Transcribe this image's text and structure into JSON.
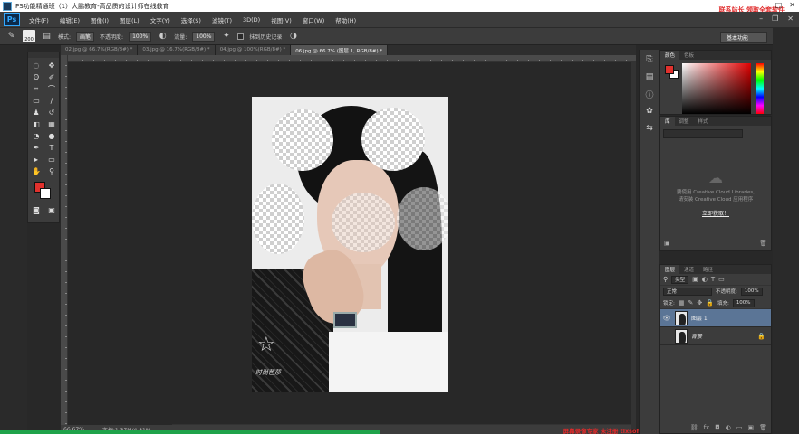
{
  "window": {
    "title": "PS功能精通班（1）大鹏教育-高品质的设计师在线教育",
    "watermark_top": "联系站长 领取全套软件"
  },
  "menu": {
    "logo": "Ps",
    "items": [
      "文件(F)",
      "编辑(E)",
      "图像(I)",
      "图层(L)",
      "文字(Y)",
      "选择(S)",
      "滤镜(T)",
      "3D(D)",
      "视图(V)",
      "窗口(W)",
      "帮助(H)"
    ]
  },
  "options": {
    "brush_size": "200",
    "mode_label": "模式:",
    "mode_value": "画笔",
    "opacity_label": "不透明度:",
    "opacity_value": "100%",
    "flow_label": "流量:",
    "flow_value": "100%",
    "history_label": "抹到历史记录",
    "workspace": "基本功能"
  },
  "tabs": [
    {
      "label": "02.jpg @ 66.7%(RGB/8#) *",
      "active": false
    },
    {
      "label": "03.jpg @ 16.7%(RGB/8#) *",
      "active": false
    },
    {
      "label": "04.jpg @ 100%(RGB/8#) *",
      "active": false
    },
    {
      "label": "06.jpg @ 66.7% (图层 1, RGB/8#) *",
      "active": true
    }
  ],
  "photo": {
    "brand": "Star",
    "caption": "时尚芭莎"
  },
  "status": {
    "zoom": "66.67%",
    "doc": "文档:1.37M/4.81M",
    "watermark_bottom": "屏幕录像专家 未注册 tlxsoft.com"
  },
  "color_panel": {
    "tabs": [
      "颜色",
      "色板"
    ],
    "fg": "#e1312d",
    "bg": "#ffffff"
  },
  "library_panel": {
    "tabs": [
      "库",
      "调整",
      "样式"
    ],
    "message_line1": "要使用 Creative Cloud Libraries,",
    "message_line2": "请安装 Creative Cloud 应用程序",
    "link": "立即获取！"
  },
  "layers_panel": {
    "tabs": [
      "图层",
      "通道",
      "路径"
    ],
    "filter": "类型",
    "blend_mode": "正常",
    "opacity_label": "不透明度:",
    "opacity_value": "100%",
    "lock_label": "锁定:",
    "fill_label": "填充:",
    "fill_value": "100%",
    "layers": [
      {
        "name": "图层 1",
        "selected": true,
        "visible": true
      },
      {
        "name": "背景",
        "selected": false,
        "visible": false,
        "locked": true
      }
    ]
  }
}
